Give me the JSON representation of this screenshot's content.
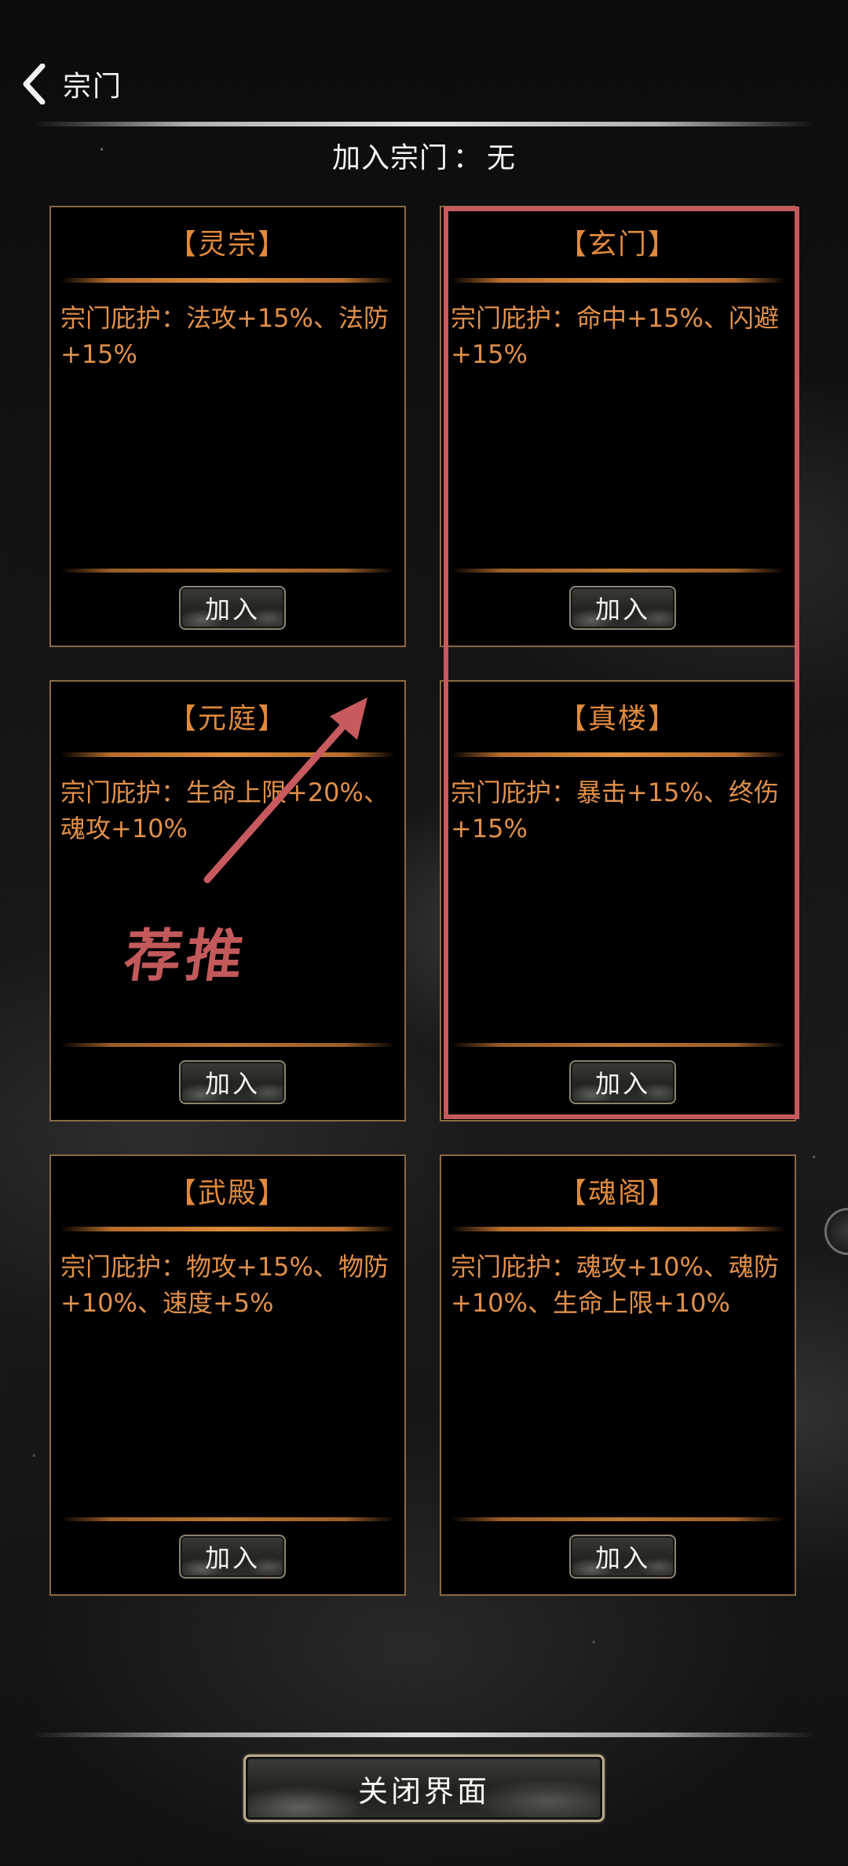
{
  "header": {
    "back_title": "宗门"
  },
  "status": {
    "label": "加入宗门",
    "separator": "：",
    "value": "无"
  },
  "sects": [
    {
      "name": "【灵宗】",
      "desc": "宗门庇护：法攻+15%、法防+15%",
      "join_label": "加入"
    },
    {
      "name": "【玄门】",
      "desc": "宗门庇护：命中+15%、闪避+15%",
      "join_label": "加入"
    },
    {
      "name": "【元庭】",
      "desc": "宗门庇护：生命上限+20%、魂攻+10%",
      "join_label": "加入"
    },
    {
      "name": "【真楼】",
      "desc": "宗门庇护：暴击+15%、终伤+15%",
      "join_label": "加入"
    },
    {
      "name": "【武殿】",
      "desc": "宗门庇护：物攻+15%、物防+10%、速度+5%",
      "join_label": "加入"
    },
    {
      "name": "【魂阁】",
      "desc": "宗门庇护：魂攻+10%、魂防+10%、生命上限+10%",
      "join_label": "加入"
    }
  ],
  "annotation": {
    "recommend_text": "荐推"
  },
  "footer": {
    "close_label": "关闭界面"
  },
  "colors": {
    "accent_orange": "#e08a3c",
    "highlight_red": "#c65a5e",
    "card_border": "#8a6a44"
  },
  "icons": {
    "back": "chevron-left-icon"
  }
}
